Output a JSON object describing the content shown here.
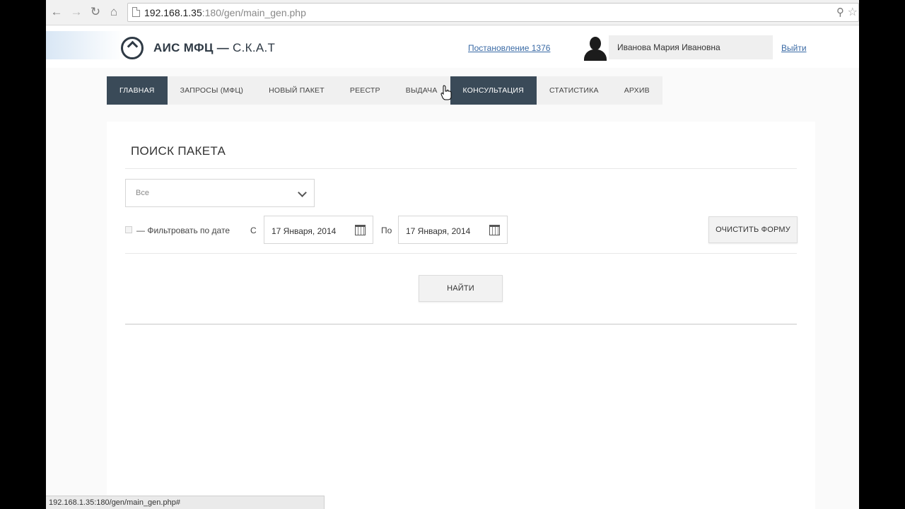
{
  "browser": {
    "url_host": "192.168.1.35",
    "url_rest": ":180/gen/main_gen.php",
    "status_url": "192.168.1.35:180/gen/main_gen.php#"
  },
  "header": {
    "logo_bold": "АИС МФЦ —",
    "logo_light": " С.К.А.Т",
    "decree_link": "Постановление 1376",
    "user_name": "Иванова Мария Ивановна",
    "logout": "Выйти"
  },
  "menu": {
    "items": [
      {
        "label": "ГЛАВНАЯ"
      },
      {
        "label": "ЗАПРОСЫ (МФЦ)"
      },
      {
        "label": "НОВЫЙ ПАКЕТ"
      },
      {
        "label": "РЕЕСТР"
      },
      {
        "label": "ВЫДАЧА"
      },
      {
        "label": "КОНСУЛЬТАЦИЯ"
      },
      {
        "label": "СТАТИСТИКА"
      },
      {
        "label": "АРХИВ"
      }
    ]
  },
  "search": {
    "title": "ПОИСК ПАКЕТА",
    "scope_value": "Все",
    "date_filter_label": "— Фильтровать по дате",
    "from_label": "С",
    "from_date": "17 Января, 2014",
    "to_label": "По",
    "to_date": "17 Января, 2014",
    "clear_button": "ОЧИСТИТЬ ФОРМУ",
    "find_button": "НАЙТИ"
  },
  "colors": {
    "menu_active": "#3a4a58",
    "link": "#3a6aa5"
  }
}
